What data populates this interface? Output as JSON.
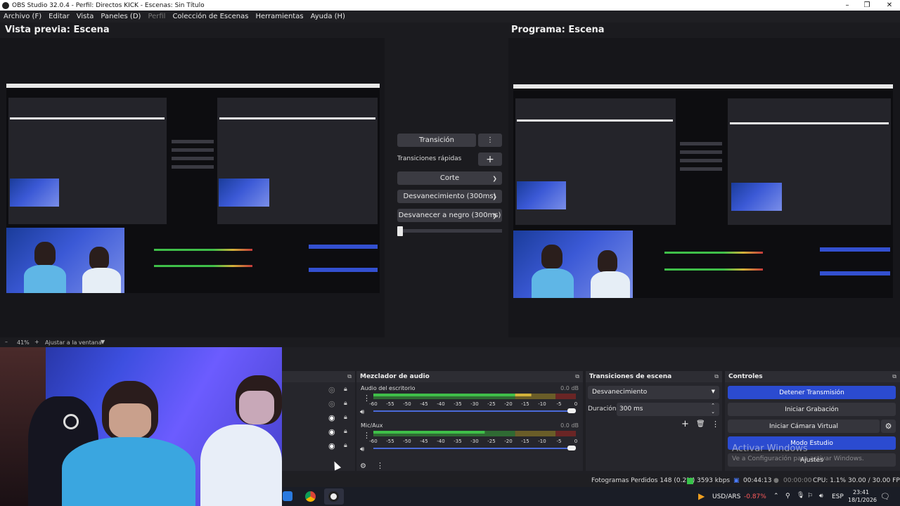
{
  "window": {
    "title": "OBS Studio 32.0.4 - Perfil: Directos KICK - Escenas: Sin Título",
    "minimize": "–",
    "maximize": "❐",
    "close": "✕"
  },
  "menu": [
    "Archivo (F)",
    "Editar",
    "Vista",
    "Paneles (D)",
    "Perfil",
    "Colección de Escenas",
    "Herramientas",
    "Ayuda (H)"
  ],
  "preview": {
    "title": "Vista previa: Escena",
    "zoom": "41%",
    "fit_label": "Ajustar a la ventana",
    "minus": "–",
    "plus": "+"
  },
  "program": {
    "title": "Programa: Escena"
  },
  "transition_panel": {
    "transition_button": "Transición",
    "quick_label": "Transiciones rápidas",
    "quick_items": [
      "Corte",
      "Desvanecimiento (300ms)",
      "Desvanecer a negro (300ms)"
    ]
  },
  "mixer": {
    "title": "Mezclador de audio",
    "scale": [
      "-60",
      "-55",
      "-50",
      "-45",
      "-40",
      "-35",
      "-30",
      "-25",
      "-20",
      "-15",
      "-10",
      "-5",
      "0"
    ],
    "channels": [
      {
        "name": "Audio del escritorio",
        "db": "0.0 dB",
        "level": 0.78,
        "volume": 1.0
      },
      {
        "name": "Mic/Aux",
        "db": "0.0 dB",
        "level": 0.55,
        "volume": 1.0
      }
    ]
  },
  "scene_transitions": {
    "title": "Transiciones de escena",
    "selected": "Desvanecimiento",
    "duration_label": "Duración",
    "duration_value": "300 ms"
  },
  "controls": {
    "title": "Controles",
    "stop_stream": "Detener Transmisión",
    "start_record": "Iniciar Grabación",
    "virtual_cam": "Iniciar Cámara Virtual",
    "studio_mode": "Modo Estudio",
    "settings": "Ajustes",
    "watermark_title": "Activar Windows",
    "watermark_sub": "Ve a Configuración para activar Windows."
  },
  "status": {
    "dropped": "Fotogramas Perdidos 148 (0.2%)",
    "bitrate": "3593 kbps",
    "stream_time": "00:44:13",
    "rec_time": "00:00:00",
    "cpu": "CPU: 1.1%",
    "fps": "30.00 / 30.00 FPS"
  },
  "taskbar": {
    "ticker_name": "USD/ARS",
    "ticker_change": "-0.87%",
    "lang": "ESP",
    "time": "23:41",
    "date": "18/1/2026"
  },
  "colors": {
    "accent_blue": "#2b4bd0",
    "meter_green": "#3fbf49",
    "meter_yellow": "#d2b23a",
    "meter_red": "#c63a3a",
    "ticker_red": "#ff5b5b"
  }
}
